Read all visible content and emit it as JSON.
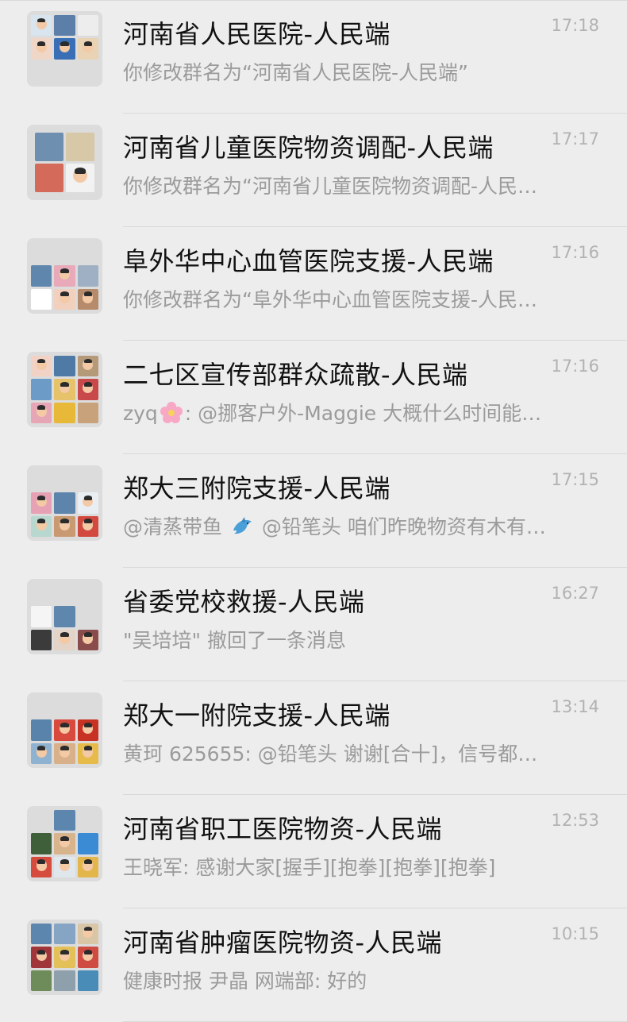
{
  "chats": [
    {
      "name": "河南省人民医院-人民端",
      "time": "17:18",
      "preview": "你修改群名为“河南省人民医院-人民端”",
      "avatar_tiles": [
        "#d8e4ee",
        "#5b7fa8",
        "#e8eef3",
        "#f0d6c6",
        "#3a6fb5",
        "#e9d3b4"
      ],
      "avatar_layout": "3x2"
    },
    {
      "name": "河南省儿童医院物资调配-人民端",
      "time": "17:17",
      "preview": "你修改群名为“河南省儿童医院物资调配-人民…",
      "avatar_tiles": [
        "#6f8fb0",
        "#d7c8a8",
        "#d46a5a",
        "#f2f2f2"
      ],
      "avatar_layout": "2x2"
    },
    {
      "name": "阜外华中心血管医院支援-人民端",
      "time": "17:16",
      "preview": "你修改群名为“阜外华中心血管医院支援-人民…",
      "avatar_tiles": [
        "#5f86ad",
        "#e8a9b9",
        "#9fb0c4",
        "#ffffff",
        "#f1d1bd",
        "#b58b6b"
      ],
      "avatar_layout": "3x2"
    },
    {
      "name": "二七区宣传部群众疏散-人民端",
      "time": "17:16",
      "preview_prefix": "zyq",
      "preview_suffix": ": @挪客户外-Maggie 大概什么时间能…",
      "avatar_tiles": [
        "#f2d2c4",
        "#4f7aa6",
        "#b59a79",
        "#6d9bc7",
        "#e6c26a",
        "#c9494a",
        "#e7a6b6",
        "#e8b838",
        "#c7a27a"
      ],
      "avatar_layout": "3x3"
    },
    {
      "name": "郑大三附院支援-人民端",
      "time": "17:15",
      "preview_prefix": "@清蒸带鱼",
      "preview_suffix": " @铅笔头 咱们昨晚物资有木有…",
      "avatar_tiles": [
        "#e6a2b4",
        "#5d84ab",
        "#e9eef2",
        "#b8d8cf",
        "#c99a72",
        "#d24a3f"
      ],
      "avatar_layout": "3x2"
    },
    {
      "name": "省委党校救援-人民端",
      "time": "16:27",
      "preview": "\"吴培培\" 撤回了一条消息",
      "avatar_tiles": [
        "#f5f5f5",
        "#5f87ad",
        "#3b3b3b",
        "#e4d3c7",
        "#8a4b4b"
      ],
      "avatar_layout": "3x2"
    },
    {
      "name": "郑大一附院支援-人民端",
      "time": "13:14",
      "preview": "黄珂 625655: @铅笔头 谢谢[合十]，信号都…",
      "avatar_tiles": [
        "#5a83ab",
        "#d84a3d",
        "#c73224",
        "#8fb2d0",
        "#d8b08a",
        "#e6bb4a"
      ],
      "avatar_layout": "3x2"
    },
    {
      "name": "河南省职工医院物资-人民端",
      "time": "12:53",
      "preview": "王晓军: 感谢大家[握手][抱拳][抱拳][抱拳]",
      "avatar_tiles": [
        "#5c86ae",
        "#3f5f3a",
        "#d7b48c",
        "#3a8bd4",
        "#d54c3f",
        "#e0e7ec",
        "#e3b64c"
      ],
      "avatar_layout": "3x3"
    },
    {
      "name": "河南省肿瘤医院物资-人民端",
      "time": "10:15",
      "preview": "健康时报 尹晶 网端部: 好的",
      "avatar_tiles": [
        "#5c86ae",
        "#86a5c4",
        "#d9c6a6",
        "#a1363a",
        "#e3c058",
        "#cf4c42",
        "#6d8c5a",
        "#8fa0ad",
        "#4a8cb8"
      ],
      "avatar_layout": "3x3"
    }
  ],
  "icons": {
    "flower_emoji": "flower-emoji",
    "dolphin_emoji": "dolphin-emoji"
  }
}
